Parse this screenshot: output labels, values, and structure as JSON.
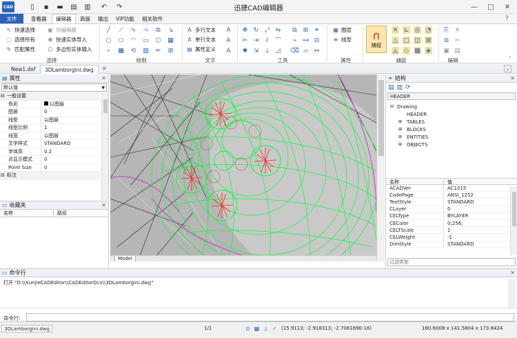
{
  "app": {
    "title": "迅捷CAD编辑器",
    "logo_text": "CAD"
  },
  "ribbon_tabs": [
    "文件",
    "查看器",
    "编辑器",
    "高级",
    "输出",
    "VIP功能",
    "相关软件"
  ],
  "ribbon": {
    "select": {
      "label": "选择",
      "quick_select": "快速选择",
      "select_all": "选择所有",
      "match_props": "匹配属性",
      "block_editor": "块编辑器",
      "quick_entity_import": "快速实体导入",
      "polygon_entity_input": "多边形实体输入"
    },
    "draw": {
      "label": "绘制"
    },
    "text": {
      "label": "文字",
      "mtext": "多行文本",
      "stext": "单行文本",
      "attdef": "属性定义"
    },
    "tools": {
      "label": "工具"
    },
    "props": {
      "label": "属性",
      "layers": "图层",
      "linetype": "线型"
    },
    "snap": {
      "label": "捕捉",
      "button": "捕捉"
    },
    "edit": {
      "label": "编辑"
    }
  },
  "doc_tabs": [
    "New1.dxf",
    "3DLamborgini.dwg"
  ],
  "properties": {
    "title": "属性",
    "selector": "默认值",
    "general_label": "一般设置",
    "rows": [
      {
        "k": "色彩",
        "v": "以图层"
      },
      {
        "k": "图层",
        "v": "0"
      },
      {
        "k": "线型",
        "v": "以图层"
      },
      {
        "k": "线型比例",
        "v": "1"
      },
      {
        "k": "线宽",
        "v": "以图层"
      },
      {
        "k": "文字样式",
        "v": "STANDARD"
      },
      {
        "k": "字体高",
        "v": "0.2"
      },
      {
        "k": "点显示模式",
        "v": "0"
      },
      {
        "k": "Point Size",
        "v": "0"
      }
    ],
    "dim_label": "标注"
  },
  "favorites": {
    "title": "收藏夹",
    "col_name": "名称",
    "col_path": "路径"
  },
  "model_tab": "Model",
  "structure": {
    "title": "结构",
    "header_btn": "HEADER",
    "root": "Drawing",
    "children": [
      "HEADER",
      "TABLES",
      "BLOCKS",
      "ENTITIES",
      "OBJECTS"
    ],
    "col_name": "名称",
    "col_value": "值",
    "rows": [
      {
        "n": "ACADVer",
        "v": "AC1015"
      },
      {
        "n": "CodePage",
        "v": "ANSI_1252"
      },
      {
        "n": "TextStyle",
        "v": "STANDARD"
      },
      {
        "n": "CLayer",
        "v": "0"
      },
      {
        "n": "CELType",
        "v": "BYLAYER"
      },
      {
        "n": "CEColor",
        "v": "0;256;"
      },
      {
        "n": "CELTScale",
        "v": "1"
      },
      {
        "n": "CELWeight",
        "v": "-1"
      },
      {
        "n": "DimStyle",
        "v": "STANDARD"
      }
    ],
    "filter_placeholder": "过滤类型"
  },
  "command": {
    "title": "命令行",
    "history": "打开 \"D:\\\\XunjieCADEditor\\\\CADEditorOcx\\\\3DLamborgini.dwg\"",
    "prompt": "命令行:"
  },
  "status": {
    "file": "3DLamborgini.dwg",
    "page": "1/1",
    "coords": "(15.9113; -2.918313; -2.706169E-16)",
    "size": "180.6008 x 141.5804 x 173.8424"
  },
  "colors": {
    "accent": "#2a63b8",
    "wire_green": "#00ff33",
    "wire_red": "#ff2020",
    "wire_magenta": "#cc33cc"
  }
}
